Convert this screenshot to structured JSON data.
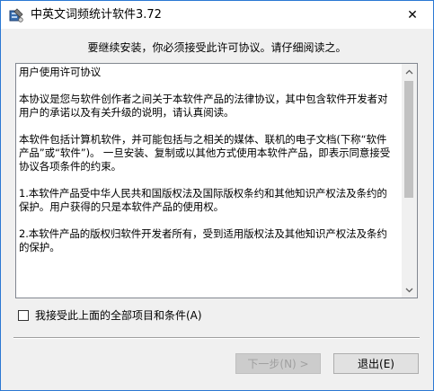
{
  "window": {
    "title": "中英文词频统计软件3.72",
    "close_glyph": "✕"
  },
  "header": {
    "text": "要继续安装，你必须接受此许可协议。请仔细阅读之。"
  },
  "license": {
    "paragraphs": [
      "用户使用许可协议",
      "本协议是您与软件创作者之间关于本软件产品的法律协议，其中包含软件开发者对用户的承诺以及有关升级的说明，请认真阅读。",
      "本软件包括计算机软件，并可能包括与之相关的媒体、联机的电子文档(下称“软件产品”或“软件”)。 一旦安装、复制或以其他方式使用本软件产品，即表示同意接受协议各项条件的约束。",
      "1.本软件产品受中华人民共和国版权法及国际版权条约和其他知识产权法及条约的保护。用户获得的只是本软件产品的使用权。",
      "2.本软件产品的版权归软件开发者所有，受到适用版权法及其他知识产权法及条约的保护。"
    ]
  },
  "agree": {
    "label": "我接受此上面的全部项目和条件(A)",
    "checked": false
  },
  "buttons": {
    "next_label": "下一步(N) >",
    "exit_label": "退出(E)"
  }
}
